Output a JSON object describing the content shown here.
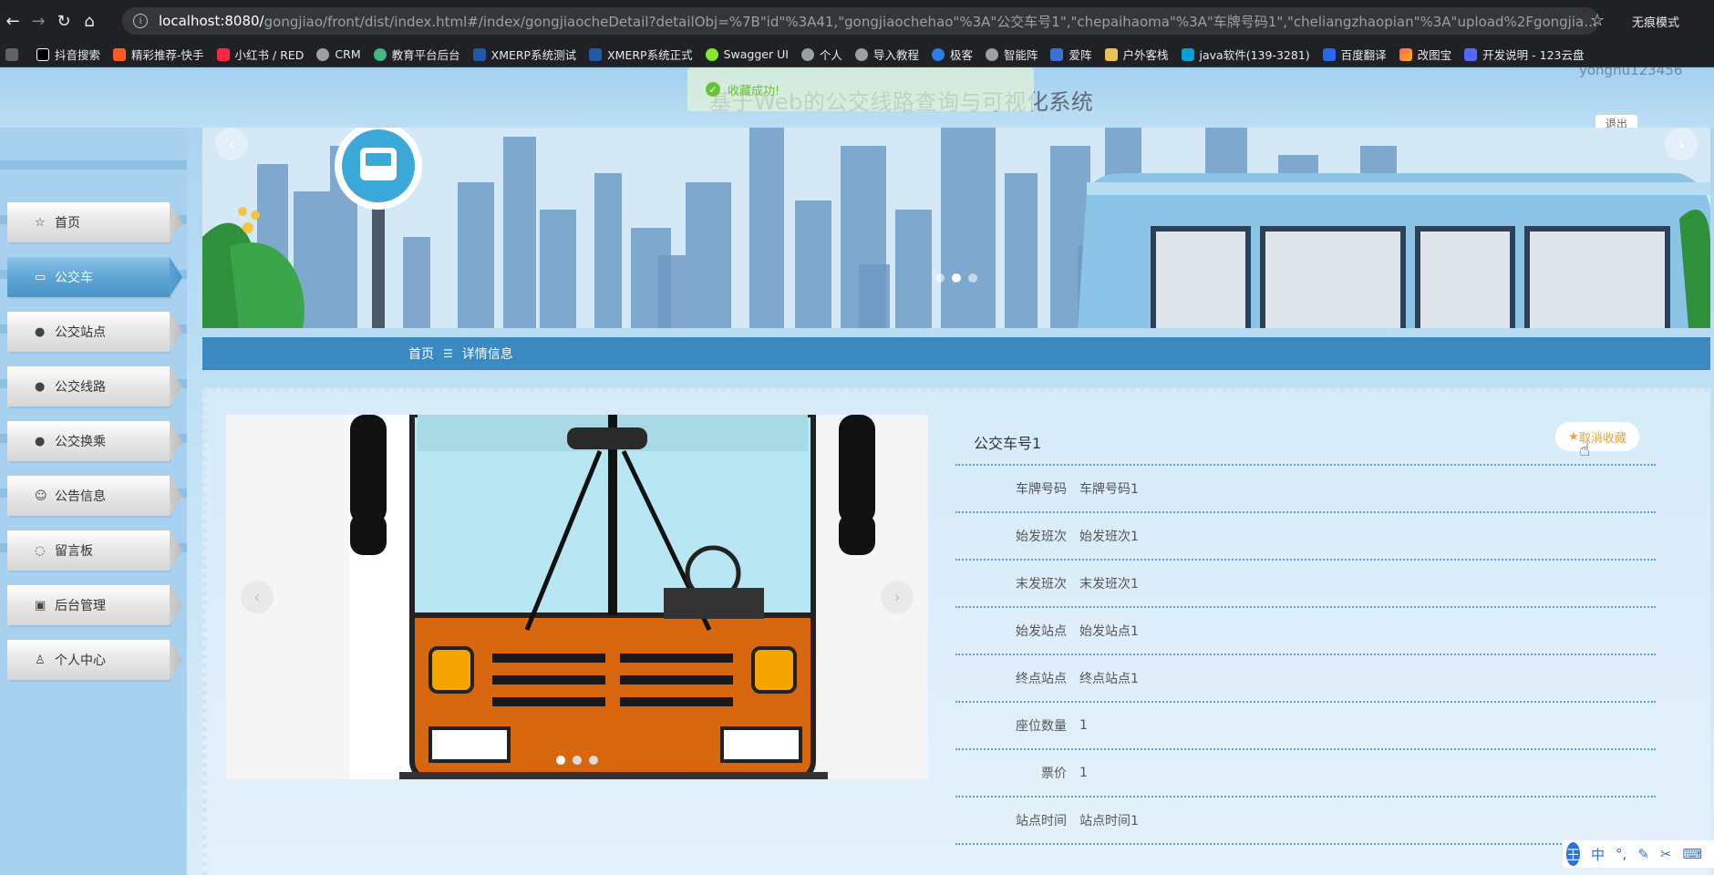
{
  "browser": {
    "url_host": "localhost:8080/",
    "url_rest": "gongjiao/front/dist/index.html#/index/gongjiaocheDetail?detailObj=%7B\"id\"%3A41,\"gongjiaochehao\"%3A\"公交车号1\",\"chepaihaoma\"%3A\"车牌号码1\",\"cheliangzhaopian\"%3A\"upload%2Fgongjiaoche_cheliangzhaopia...",
    "mode_label": "无痕模式",
    "bookmarks": [
      "抖音搜索",
      "精彩推荐-快手",
      "小红书 / RED",
      "CRM",
      "教育平台后台",
      "XMERP系统测试",
      "XMERP系统正式",
      "Swagger UI",
      "个人",
      "导入教程",
      "极客",
      "智能阵",
      "爱阵",
      "户外客栈",
      "java软件(139-3281)",
      "百度翻译",
      "改图宝",
      "开发说明 - 123云盘"
    ]
  },
  "header": {
    "site_title": "基于Web的公交线路查询与可视化系统",
    "username": "yonghu123456",
    "logout_label": "退出",
    "toast": "收藏成功!"
  },
  "sidebar": {
    "items": [
      {
        "label": "首页",
        "icon": "star-icon"
      },
      {
        "label": "公交车",
        "icon": "bag-icon"
      },
      {
        "label": "公交站点",
        "icon": "alert-icon"
      },
      {
        "label": "公交线路",
        "icon": "help-icon"
      },
      {
        "label": "公交换乘",
        "icon": "info-icon"
      },
      {
        "label": "公告信息",
        "icon": "smile-icon"
      },
      {
        "label": "留言板",
        "icon": "chat-icon"
      },
      {
        "label": "后台管理",
        "icon": "box-icon"
      },
      {
        "label": "个人中心",
        "icon": "user-icon"
      }
    ]
  },
  "breadcrumb": {
    "home": "首页",
    "current": "详情信息"
  },
  "detail": {
    "title": "公交车号1",
    "favorite_label": "取消收藏",
    "fields": [
      {
        "label": "车牌号码",
        "value": "车牌号码1"
      },
      {
        "label": "始发班次",
        "value": "始发班次1"
      },
      {
        "label": "末发班次",
        "value": "末发班次1"
      },
      {
        "label": "始发站点",
        "value": "始发站点1"
      },
      {
        "label": "终点站点",
        "value": "终点站点1"
      },
      {
        "label": "座位数量",
        "value": "1"
      },
      {
        "label": "票价",
        "value": "1"
      },
      {
        "label": "站点时间",
        "value": "站点时间1"
      }
    ]
  },
  "ime": {
    "lang": "中",
    "logo": "王"
  },
  "colors": {
    "accent": "#3a89c0",
    "sidebar_active": "#5fa6d6",
    "favorite": "#e6a23c",
    "toast_green": "#67c23a"
  }
}
